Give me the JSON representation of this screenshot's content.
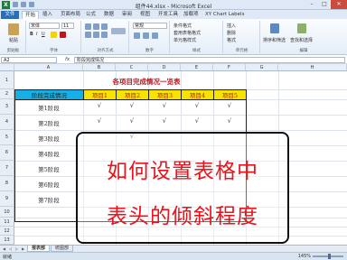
{
  "window": {
    "title": "组件44.xlsx - Microsoft Excel",
    "min": "–",
    "max": "□",
    "close": "✕"
  },
  "ribbon_tabs": [
    {
      "label": "文件"
    },
    {
      "label": "开始"
    },
    {
      "label": "插入"
    },
    {
      "label": "页面布局"
    },
    {
      "label": "公式"
    },
    {
      "label": "数据"
    },
    {
      "label": "审阅"
    },
    {
      "label": "视图"
    },
    {
      "label": "开发工具"
    },
    {
      "label": "加载项"
    },
    {
      "label": "XY Chart Labels"
    }
  ],
  "ribbon": {
    "paste": "粘贴",
    "font_name": "宋体",
    "font_size": "11",
    "bold": "B",
    "italic": "I",
    "underline": "U",
    "wrap": "常规",
    "cond_format": "条件格式",
    "as_table": "套用表格格式",
    "cell_style": "单元格样式",
    "insert": "插入",
    "delete": "删除",
    "format": "格式",
    "sort_filter": "排序和筛选",
    "find_select": "查找和选择",
    "group_labels": [
      "剪贴板",
      "字体",
      "对齐方式",
      "数字",
      "样式",
      "单元格",
      "编辑"
    ]
  },
  "formula_bar": {
    "name_box": "A2",
    "fx": "fx",
    "content": "阶段完成情况"
  },
  "columns": [
    "A",
    "B",
    "C",
    "D",
    "E",
    "F",
    "G",
    "H"
  ],
  "rows": [
    "1",
    "2",
    "3",
    "4",
    "5",
    "6",
    "7",
    "8",
    "9",
    "10",
    "11",
    "12",
    "13"
  ],
  "sheet": {
    "title": "各项目完成情况一览表",
    "header_first": "阶段完成情况",
    "headers": [
      "项目1",
      "项目2",
      "项目3",
      "项目4",
      "项目5"
    ],
    "row_labels": [
      "第1阶段",
      "第2阶段",
      "第3阶段",
      "第4阶段",
      "第5阶段",
      "第6阶段",
      "第7阶段"
    ],
    "checks": [
      [
        "√",
        "√",
        "√",
        "√",
        "√"
      ],
      [
        "√",
        "√",
        "√",
        "√",
        "√"
      ],
      [
        "",
        "√",
        "",
        "",
        ""
      ]
    ]
  },
  "overlay": {
    "line1": "如何设置表格中",
    "line2": "表头的倾斜程度"
  },
  "sheet_tabs": [
    {
      "label": "报表部"
    },
    {
      "label": "统图部"
    }
  ],
  "status": {
    "ready": "就绪",
    "zoom": "145%"
  }
}
